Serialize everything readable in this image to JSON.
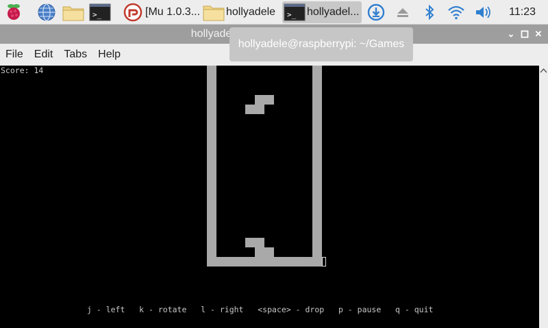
{
  "taskbar": {
    "tasks": [
      {
        "label": "",
        "icon": "terminal-icon"
      },
      {
        "label": "[Mu 1.0.3...",
        "icon": "mu-editor-icon"
      },
      {
        "label": "hollyadele",
        "icon": "folder-icon"
      },
      {
        "label": "hollyadel...",
        "icon": "terminal-icon"
      }
    ],
    "clock": "11:23"
  },
  "window": {
    "title": "hollyadele@raspberrypi: ~/Games",
    "tooltip": "hollyadele@raspberrypi: ~/Games"
  },
  "menu": {
    "file": "File",
    "edit": "Edit",
    "tabs": "Tabs",
    "help": "Help"
  },
  "game": {
    "score_text": "Score: 14",
    "controls_text": "j - left   k - rotate   l - right   <space> - drop   p - pause   q - quit"
  },
  "colors": {
    "blocks": "#a9a9a9",
    "terminal_bg": "#000000",
    "accent": "#4a90d9"
  }
}
